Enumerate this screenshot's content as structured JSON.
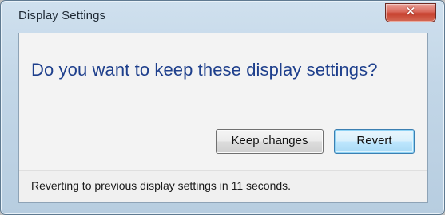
{
  "window": {
    "title": "Display Settings",
    "close_glyph": "✕"
  },
  "dialog": {
    "main_instruction": "Do you want to keep these display settings?",
    "buttons": {
      "keep_label": "Keep changes",
      "revert_label": "Revert"
    },
    "status_text": "Reverting to previous display settings in 11 seconds."
  },
  "colors": {
    "instruction_text": "#1e3f8c",
    "close_button": "#c7412f",
    "default_button_border": "#3c7fb1"
  },
  "icons": {
    "close": "close-icon"
  }
}
